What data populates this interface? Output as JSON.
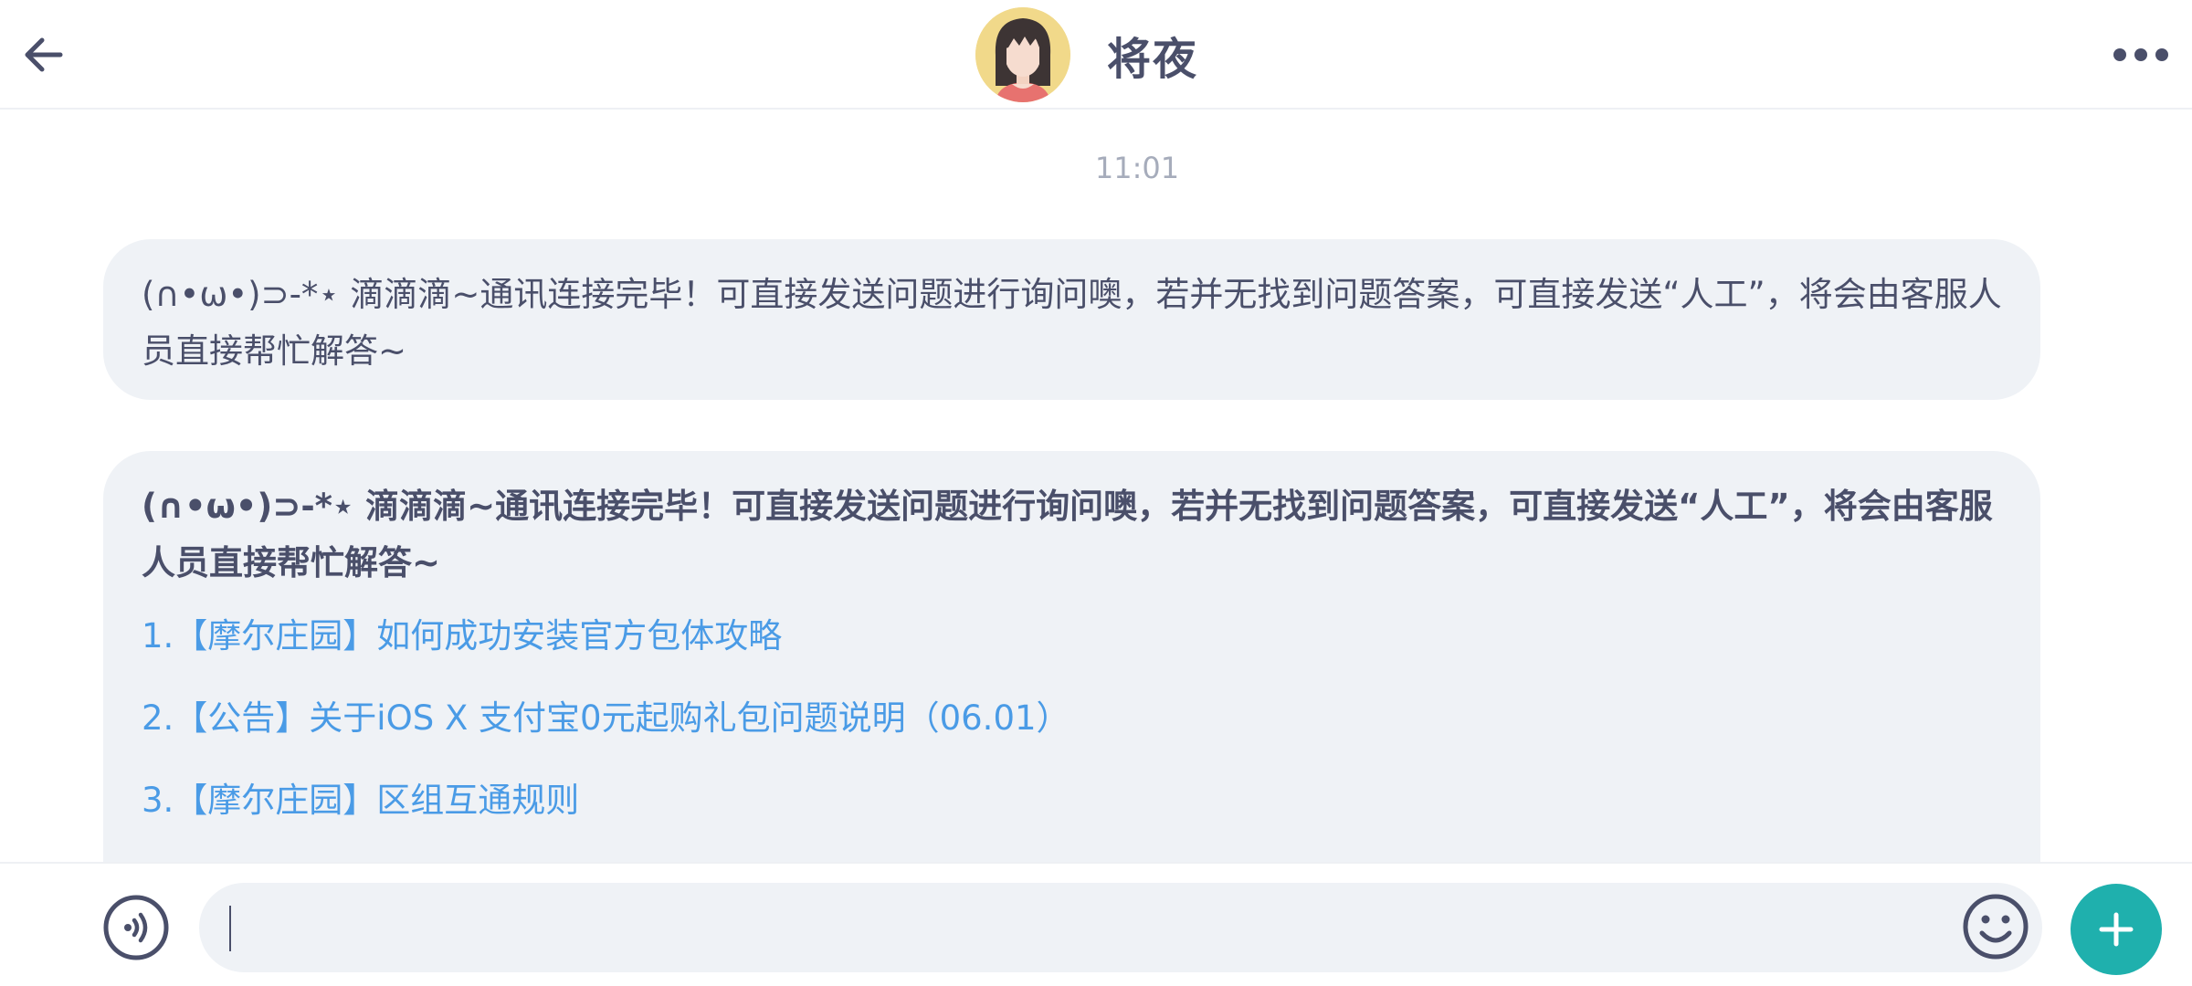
{
  "header": {
    "title": "将夜"
  },
  "chat": {
    "timestamp": "11:01",
    "messages": [
      {
        "text": "(∩•ω•)⊃-*⋆ 滴滴滴~通讯连接完毕！可直接发送问题进行询问噢，若并无找到问题答案，可直接发送“人工”，将会由客服人员直接帮忙解答~"
      },
      {
        "text": "(∩•ω•)⊃-*⋆ 滴滴滴~通讯连接完毕！可直接发送问题进行询问噢，若并无找到问题答案，可直接发送“人工”，将会由客服人员直接帮忙解答~",
        "links": [
          "1.【摩尔庄园】如何成功安装官方包体攻略",
          "2.【公告】关于iOS X 支付宝0元起购礼包问题说明（06.01）",
          "3.【摩尔庄园】区组互通规则"
        ]
      }
    ]
  },
  "input": {
    "value": "",
    "placeholder": ""
  },
  "colors": {
    "accent": "#1fb0ad",
    "link": "#4a9be6",
    "bubble": "#eff2f6",
    "text": "#4a4f6a"
  },
  "icons": {
    "back": "arrow-left-icon",
    "more": "more-dots-icon",
    "voice": "voice-icon",
    "emoji": "emoji-icon",
    "plus": "plus-icon"
  }
}
